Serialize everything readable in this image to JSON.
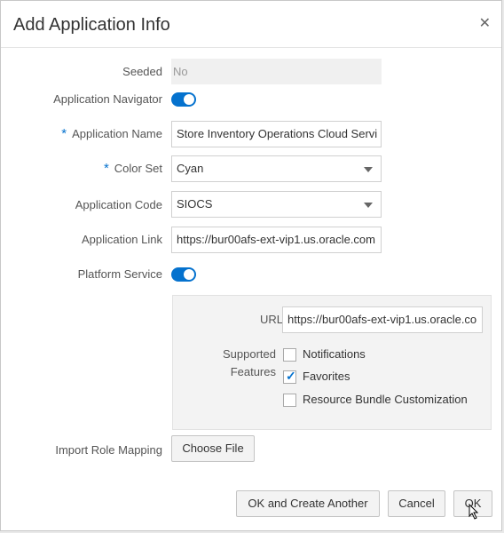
{
  "dialog": {
    "title": "Add Application Info",
    "close_icon": "close-icon",
    "accent_color": "#0572ce"
  },
  "form": {
    "seeded": {
      "label": "Seeded",
      "value": "No"
    },
    "application_navigator": {
      "label": "Application Navigator",
      "enabled": true
    },
    "application_name": {
      "label": "Application Name",
      "required": "*",
      "value": "Store Inventory Operations Cloud Servi"
    },
    "color_set": {
      "label": "Color Set",
      "required": "*",
      "value": "Cyan"
    },
    "application_code": {
      "label": "Application Code",
      "value": "SIOCS"
    },
    "application_link": {
      "label": "Application Link",
      "value": "https://bur00afs-ext-vip1.us.oracle.com"
    },
    "platform_service": {
      "label": "Platform Service",
      "enabled": true
    },
    "url": {
      "label": "URL",
      "value": "https://bur00afs-ext-vip1.us.oracle.co"
    },
    "supported_features": {
      "label_line1": "Supported",
      "label_line2": "Features",
      "options": [
        {
          "label": "Notifications",
          "checked": false
        },
        {
          "label": "Favorites",
          "checked": true
        },
        {
          "label": "Resource Bundle Customization",
          "checked": false
        }
      ]
    },
    "import_role_mapping": {
      "label": "Import Role Mapping",
      "button": "Choose File"
    }
  },
  "footer": {
    "ok_and_create": "OK and Create Another",
    "cancel": "Cancel",
    "ok": "OK"
  }
}
